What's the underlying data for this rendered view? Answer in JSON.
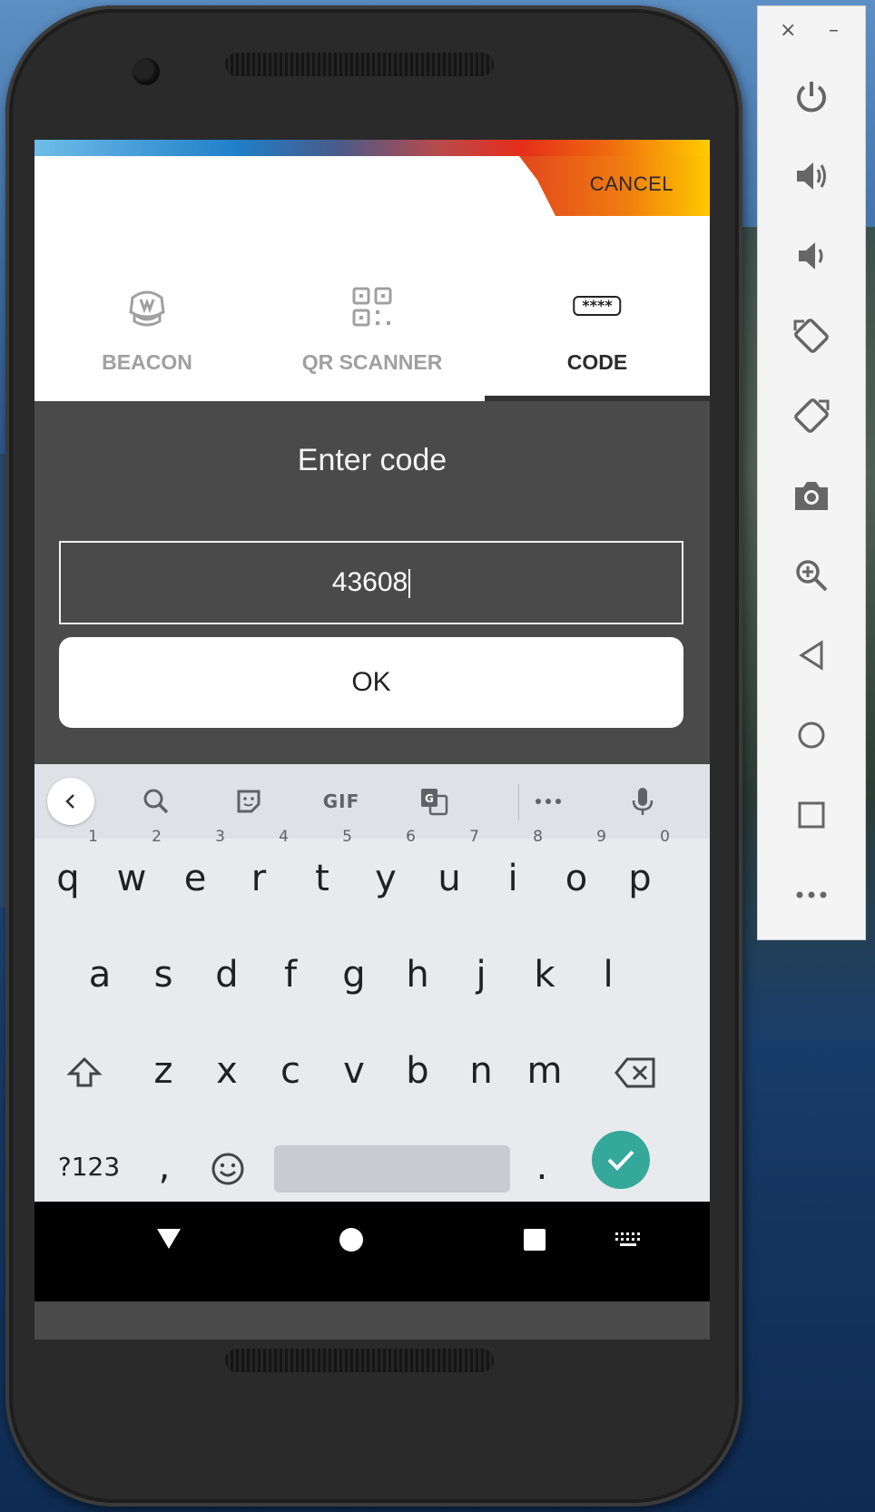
{
  "app": {
    "cancel_label": "CANCEL",
    "tabs": [
      {
        "label": "BEACON",
        "icon": "beacon-icon",
        "active": false
      },
      {
        "label": "QR SCANNER",
        "icon": "qr-code-icon",
        "active": false
      },
      {
        "label": "CODE",
        "icon": "code-icon",
        "active": true
      }
    ],
    "code_icon_text": "****",
    "title": "Enter code",
    "code_value": "43608",
    "ok_label": "OK"
  },
  "keyboard": {
    "toolbar": [
      "back-icon",
      "search-icon",
      "sticker-icon",
      "gif-icon",
      "translate-icon",
      "more-icon",
      "mic-icon"
    ],
    "gif_label": "GIF",
    "row1": [
      {
        "k": "q",
        "n": "1"
      },
      {
        "k": "w",
        "n": "2"
      },
      {
        "k": "e",
        "n": "3"
      },
      {
        "k": "r",
        "n": "4"
      },
      {
        "k": "t",
        "n": "5"
      },
      {
        "k": "y",
        "n": "6"
      },
      {
        "k": "u",
        "n": "7"
      },
      {
        "k": "i",
        "n": "8"
      },
      {
        "k": "o",
        "n": "9"
      },
      {
        "k": "p",
        "n": "0"
      }
    ],
    "row2": [
      "a",
      "s",
      "d",
      "f",
      "g",
      "h",
      "j",
      "k",
      "l"
    ],
    "row3": [
      "z",
      "x",
      "c",
      "v",
      "b",
      "n",
      "m"
    ],
    "symbols_label": "?123",
    "comma": ",",
    "period": ".",
    "colors": {
      "enter": "#34a89a",
      "bg": "#e8eaed"
    }
  },
  "emulator_panel": {
    "buttons": [
      "power-icon",
      "volume-up-icon",
      "volume-down-icon",
      "rotate-left-icon",
      "rotate-right-icon",
      "camera-icon",
      "zoom-icon",
      "back-icon",
      "home-icon",
      "overview-icon",
      "more-icon"
    ],
    "close": "×",
    "minimize": "–"
  }
}
